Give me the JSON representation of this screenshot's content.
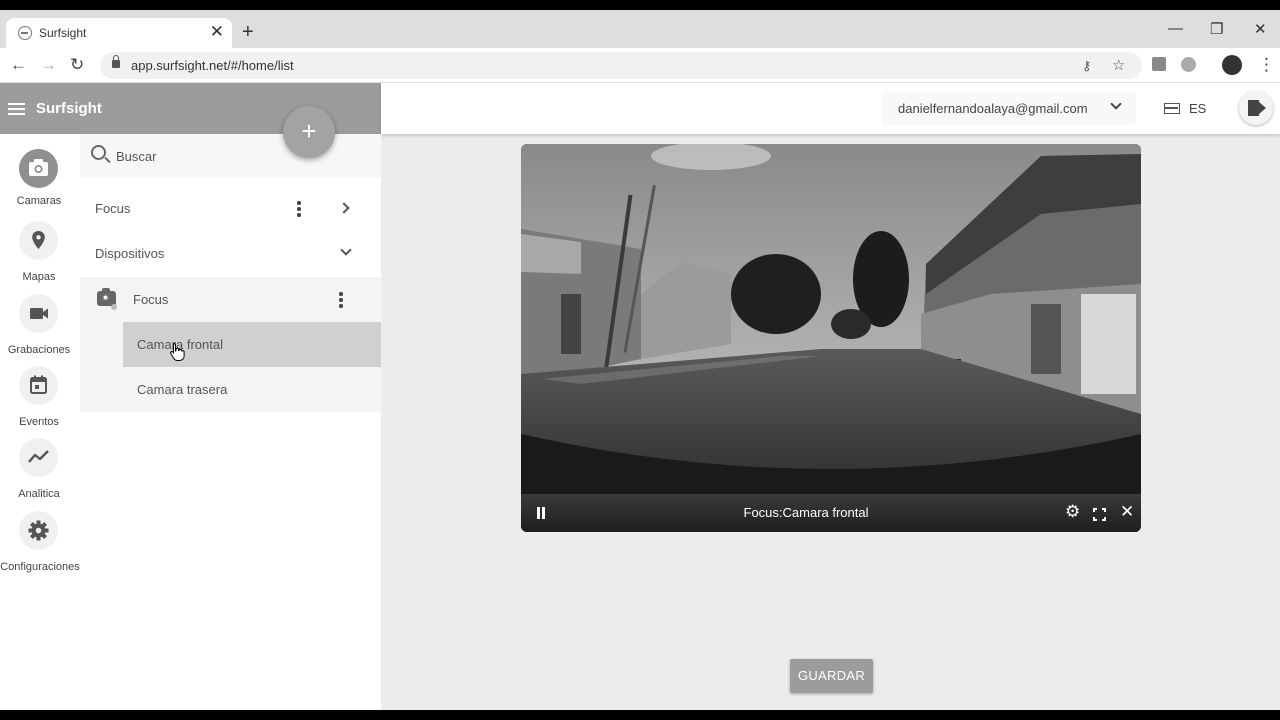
{
  "browser": {
    "tab_title": "Surfsight",
    "url": "app.surfsight.net/#/home/list"
  },
  "app": {
    "brand": "Surfsight",
    "user_email": "danielfernandoalaya@gmail.com",
    "language": "ES"
  },
  "rail": {
    "items": [
      {
        "label": "Camaras",
        "icon": "camera-icon",
        "active": true
      },
      {
        "label": "Mapas",
        "icon": "map-pin-icon"
      },
      {
        "label": "Grabaciones",
        "icon": "video-camera-icon"
      },
      {
        "label": "Eventos",
        "icon": "calendar-icon"
      },
      {
        "label": "Analitica",
        "icon": "trend-line-icon"
      },
      {
        "label": "Configuraciones",
        "icon": "gear-icon"
      }
    ]
  },
  "panel": {
    "search_placeholder": "Buscar",
    "group_focus": "Focus",
    "group_devices": "Dispositivos",
    "device_name": "Focus",
    "cameras": [
      "Camara frontal",
      "Camara trasera"
    ],
    "selected_camera": "Camara frontal"
  },
  "player": {
    "title": "Focus:Camara frontal"
  },
  "actions": {
    "save": "GUARDAR"
  }
}
